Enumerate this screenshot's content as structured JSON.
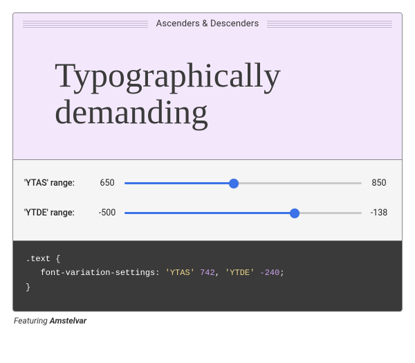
{
  "header": {
    "title": "Ascenders & Descenders"
  },
  "preview": {
    "text": "Typographically\ndemanding"
  },
  "sliders": [
    {
      "name": "ytas",
      "label": "'YTAS' range:",
      "min": 650,
      "max": 850,
      "value": 742
    },
    {
      "name": "ytde",
      "label": "'YTDE' range:",
      "min": -500,
      "max": -138,
      "value": -240
    }
  ],
  "code": {
    "selector": ".text",
    "property": "font-variation-settings",
    "axis1_name": "'YTAS'",
    "axis1_value": "742",
    "axis2_name": "'YTDE'",
    "axis2_value": "-240"
  },
  "caption": {
    "prefix": "Featuring ",
    "font_name": "Amstelvar"
  }
}
